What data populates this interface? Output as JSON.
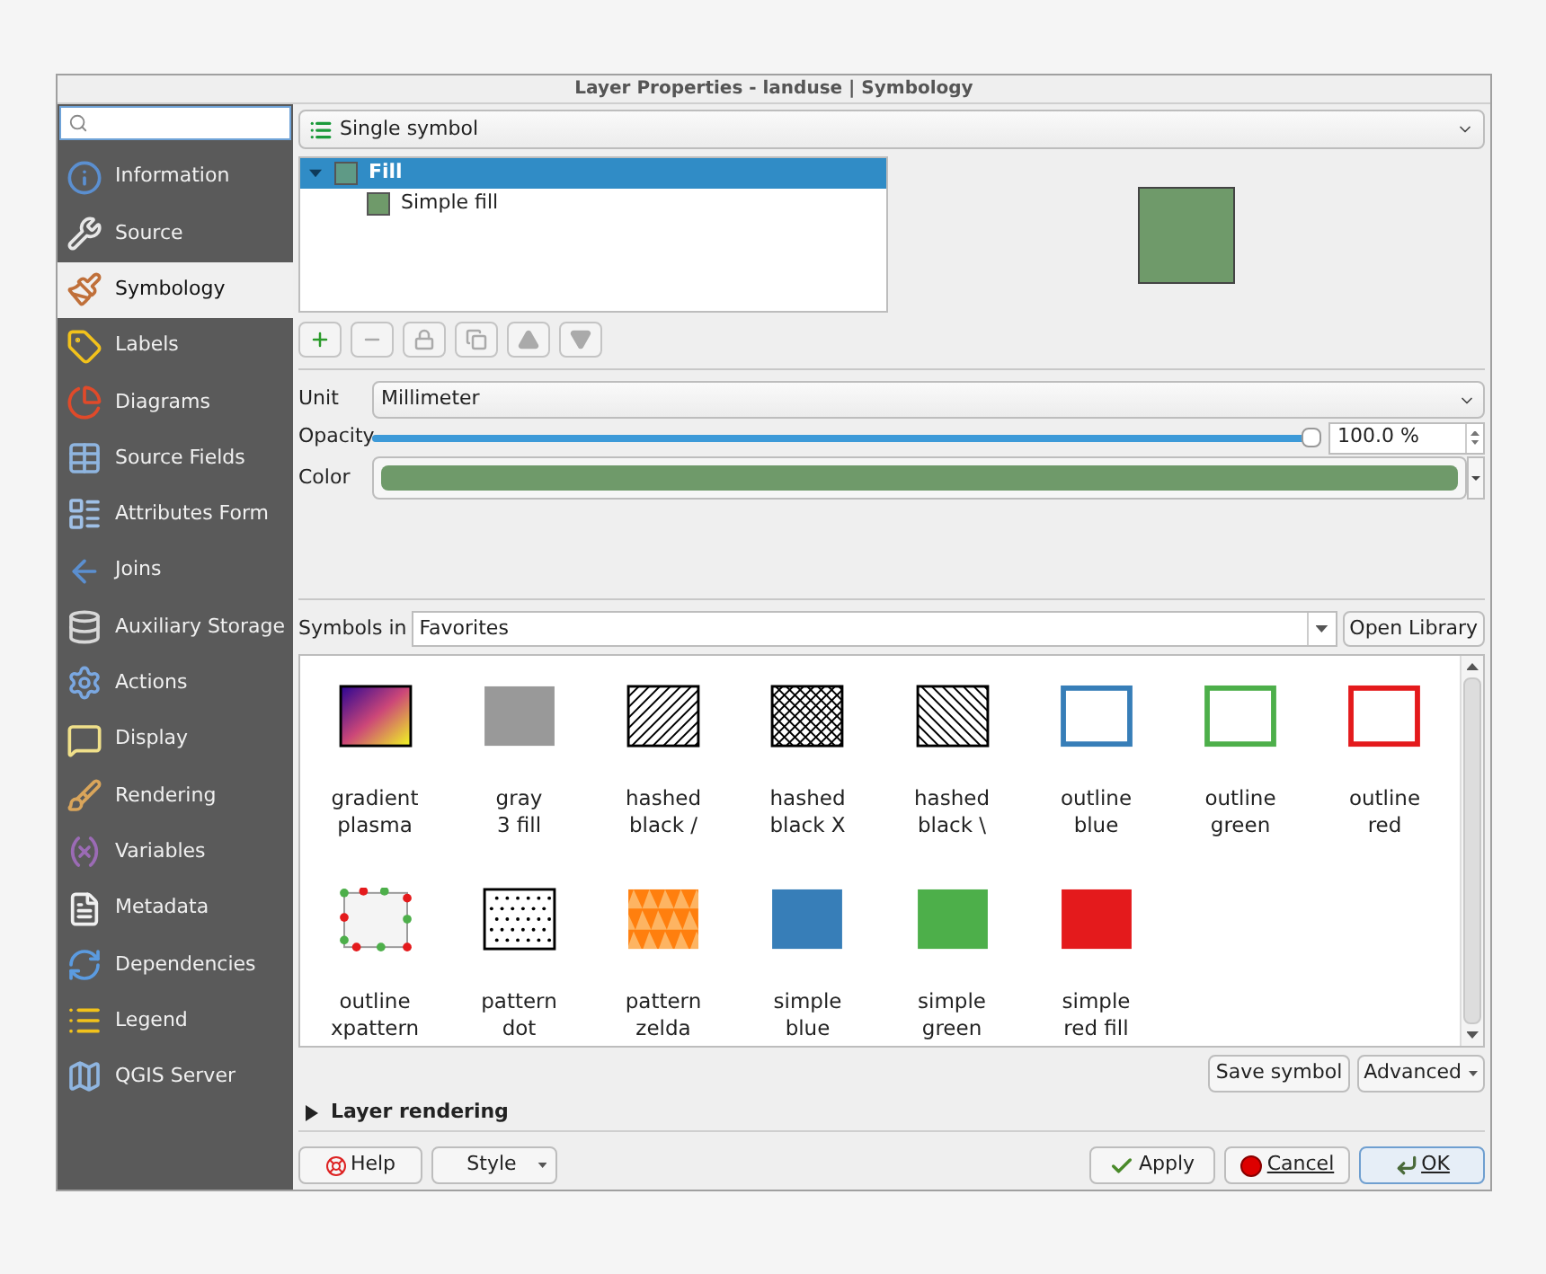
{
  "window": {
    "title": "Layer Properties - landuse | Symbology"
  },
  "sidebar": {
    "items": [
      {
        "label": "Information",
        "selected": false
      },
      {
        "label": "Source",
        "selected": false
      },
      {
        "label": "Symbology",
        "selected": true
      },
      {
        "label": "Labels",
        "selected": false
      },
      {
        "label": "Diagrams",
        "selected": false
      },
      {
        "label": "Source Fields",
        "selected": false
      },
      {
        "label": "Attributes Form",
        "selected": false
      },
      {
        "label": "Joins",
        "selected": false
      },
      {
        "label": "Auxiliary Storage",
        "selected": false
      },
      {
        "label": "Actions",
        "selected": false
      },
      {
        "label": "Display",
        "selected": false
      },
      {
        "label": "Rendering",
        "selected": false
      },
      {
        "label": "Variables",
        "selected": false
      },
      {
        "label": "Metadata",
        "selected": false
      },
      {
        "label": "Dependencies",
        "selected": false
      },
      {
        "label": "Legend",
        "selected": false
      },
      {
        "label": "QGIS Server",
        "selected": false
      }
    ]
  },
  "renderer": {
    "value": "Single symbol"
  },
  "symbol_tree": {
    "items": [
      {
        "label": "Fill",
        "selected": true,
        "expanded": true,
        "color": "#5f9a86",
        "children": [
          {
            "label": "Simple fill",
            "selected": false,
            "color": "#6f9a6a"
          }
        ]
      }
    ]
  },
  "preview": {
    "color": "#6f9a6a"
  },
  "properties": {
    "unit": {
      "label": "Unit",
      "value": "Millimeter"
    },
    "opacity": {
      "label": "Opacity",
      "level": 1,
      "reading": "100.0 %"
    },
    "color": {
      "label": "Color",
      "color": "#6f9a6a"
    }
  },
  "library": {
    "label": "Symbols in",
    "value": "Favorites",
    "open_button": "Open Library",
    "symbols": [
      {
        "name": "gradient\nplasma",
        "kind": "gradient"
      },
      {
        "name": "gray\n3 fill",
        "kind": "solid",
        "color": "#999999"
      },
      {
        "name": "hashed\nblack /",
        "kind": "hash-forward"
      },
      {
        "name": "hashed\nblack X",
        "kind": "hash-cross"
      },
      {
        "name": "hashed\nblack \\",
        "kind": "hash-back"
      },
      {
        "name": "outline\nblue",
        "kind": "outline",
        "color": "#377eb8"
      },
      {
        "name": "outline\ngreen",
        "kind": "outline",
        "color": "#4daf4a"
      },
      {
        "name": "outline\nred",
        "kind": "outline",
        "color": "#e41a1c"
      },
      {
        "name": "outline\nxpattern",
        "kind": "xpattern"
      },
      {
        "name": "pattern\ndot",
        "kind": "dots"
      },
      {
        "name": "pattern\nzelda",
        "kind": "zelda"
      },
      {
        "name": "simple\nblue",
        "kind": "solid",
        "color": "#377eb8"
      },
      {
        "name": "simple\ngreen",
        "kind": "solid",
        "color": "#4daf4a"
      },
      {
        "name": "simple\nred fill",
        "kind": "solid",
        "color": "#e41a1c"
      }
    ]
  },
  "symbol_buttons": [
    "Save symbol",
    "Advanced"
  ],
  "layer_rendering": {
    "label": "Layer rendering",
    "expanded": false
  },
  "buttons": {
    "help": "Help",
    "style": "Style",
    "apply": "Apply",
    "cancel": "Cancel",
    "ok": "OK"
  }
}
